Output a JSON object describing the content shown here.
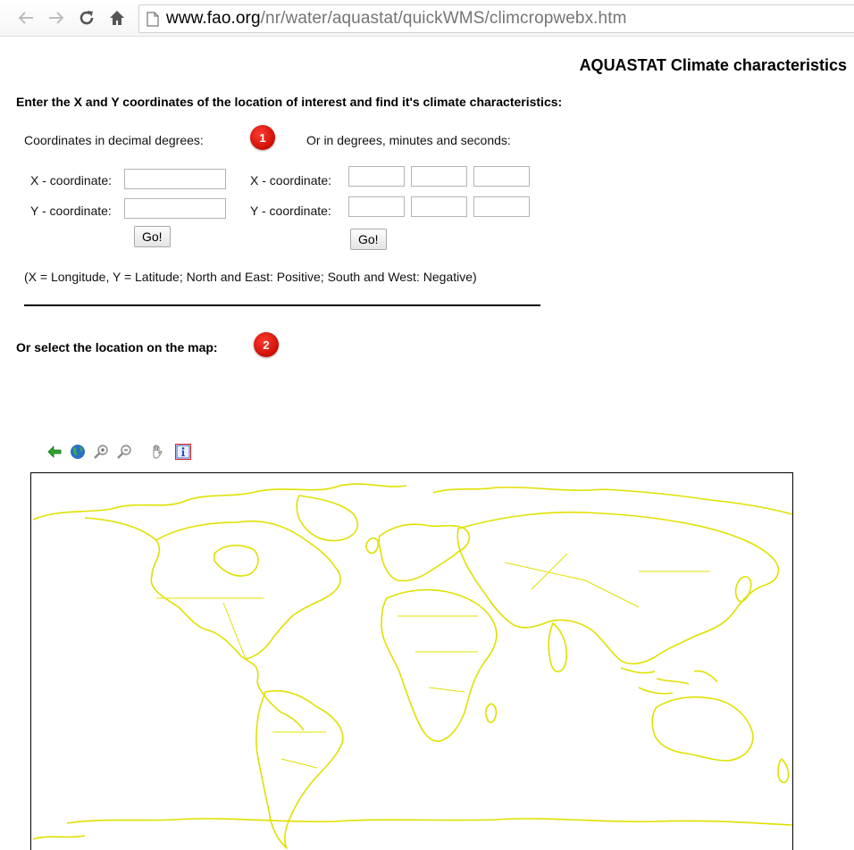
{
  "browser": {
    "url_host": "www.fao.org",
    "url_path": "/nr/water/aquastat/quickWMS/climcropwebx.htm"
  },
  "page": {
    "title": "AQUASTAT Climate characteristics",
    "intro": "Enter the X and Y coordinates of the location of interest and find it's climate characteristics:",
    "decimal_heading": "Coordinates in decimal degrees:",
    "dms_heading": "Or in degrees, minutes and seconds:",
    "badge_1": "1",
    "badge_2": "2",
    "x_label": "X - coordinate:",
    "y_label": "Y - coordinate:",
    "go_label": "Go!",
    "note": "(X = Longitude, Y = Latitude; North and East: Positive; South and West: Negative)",
    "map_prompt": "Or select the location on the map:"
  },
  "map_toolbar": [
    "back-arrow-icon",
    "globe-icon",
    "zoom-in-icon",
    "zoom-out-icon",
    "pan-hand-icon",
    "info-icon"
  ],
  "colors": {
    "coastline": "#e0e000",
    "badge": "#e0120a",
    "info_border": "#e02020"
  }
}
